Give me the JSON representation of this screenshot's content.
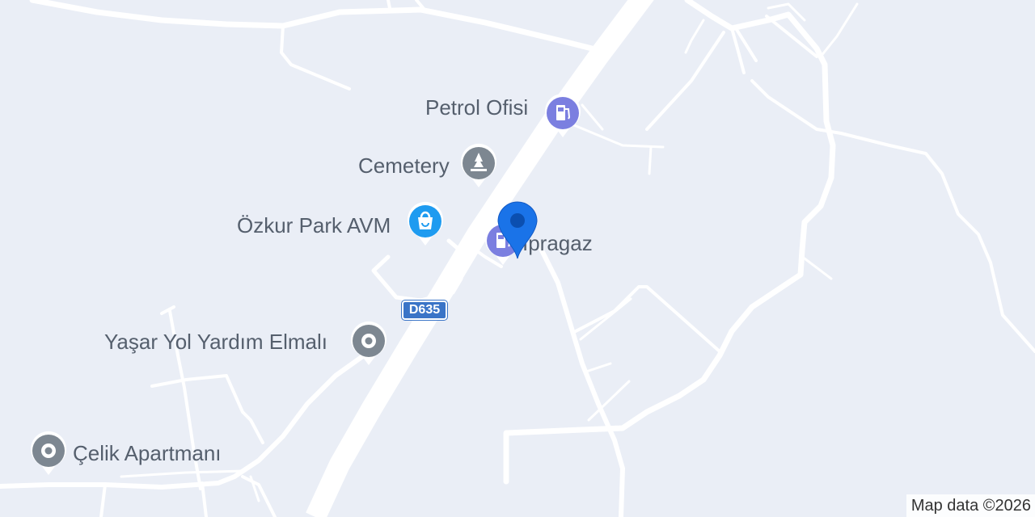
{
  "map": {
    "colors": {
      "background": "#eaeef6",
      "road": "#ffffff",
      "label": "#555f6d",
      "fuel_pin": "#7b7fe0",
      "shopping_pin": "#1e9bf0",
      "cemetery_pin": "#7d8791",
      "generic_pin": "#7d8791",
      "marker": "#1a73e8",
      "marker_dot": "#0b4fb0",
      "route_shield": "#3a74c7"
    },
    "route_shield": "D635",
    "pois": [
      {
        "id": "petrol-ofisi",
        "label": "Petrol Ofisi",
        "icon": "fuel-icon"
      },
      {
        "id": "cemetery",
        "label": "Cemetery",
        "icon": "cemetery-icon"
      },
      {
        "id": "ozkur-park-avm",
        "label": "Özkur Park AVM",
        "icon": "shopping-bag-icon"
      },
      {
        "id": "ipragaz",
        "label": "İpragaz",
        "icon": "fuel-icon"
      },
      {
        "id": "yasar-yol-yardim",
        "label": "Yaşar Yol Yardım Elmalı",
        "icon": "place-icon"
      },
      {
        "id": "celik-apartmani",
        "label": "Çelik Apartmanı",
        "icon": "place-icon"
      }
    ],
    "attribution": "Map data ©2026"
  }
}
